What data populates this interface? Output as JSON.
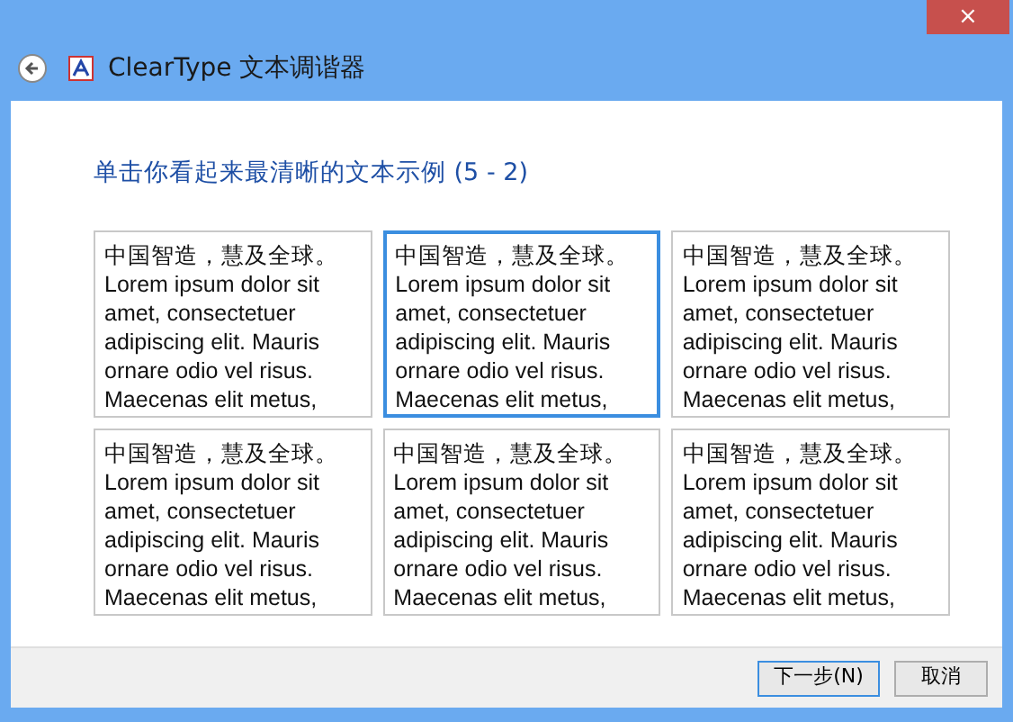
{
  "window": {
    "title": "ClearType 文本调谐器",
    "close": "×"
  },
  "heading": "单击你看起来最清晰的文本示例 (5 - 2)",
  "samples": [
    {
      "selected": false,
      "lines": [
        "中国智造，慧及全球。",
        "Lorem ipsum dolor sit",
        "amet, consectetuer",
        "adipiscing elit. Mauris",
        "ornare odio vel risus.",
        "Maecenas elit metus,"
      ]
    },
    {
      "selected": true,
      "lines": [
        "中国智造，慧及全球。",
        "Lorem ipsum dolor sit",
        "amet, consectetuer",
        "adipiscing elit. Mauris",
        "ornare odio vel risus.",
        "Maecenas elit metus,"
      ]
    },
    {
      "selected": false,
      "lines": [
        "中国智造，慧及全球。",
        "Lorem ipsum dolor sit",
        "amet, consectetuer",
        "adipiscing elit. Mauris",
        "ornare odio vel risus.",
        "Maecenas elit metus,"
      ]
    },
    {
      "selected": false,
      "lines": [
        "中国智造，慧及全球。",
        "Lorem ipsum dolor sit",
        "amet, consectetuer",
        "adipiscing elit. Mauris",
        "ornare odio vel risus.",
        "Maecenas elit metus,"
      ]
    },
    {
      "selected": false,
      "lines": [
        "中国智造，慧及全球。",
        "Lorem ipsum dolor sit",
        "amet, consectetuer",
        "adipiscing elit. Mauris",
        "ornare odio vel risus.",
        "Maecenas elit metus,"
      ]
    },
    {
      "selected": false,
      "lines": [
        "中国智造，慧及全球。",
        "Lorem ipsum dolor sit",
        "amet, consectetuer",
        "adipiscing elit. Mauris",
        "ornare odio vel risus.",
        "Maecenas elit metus,"
      ]
    }
  ],
  "buttons": [
    "下一步(N)",
    "取消"
  ]
}
